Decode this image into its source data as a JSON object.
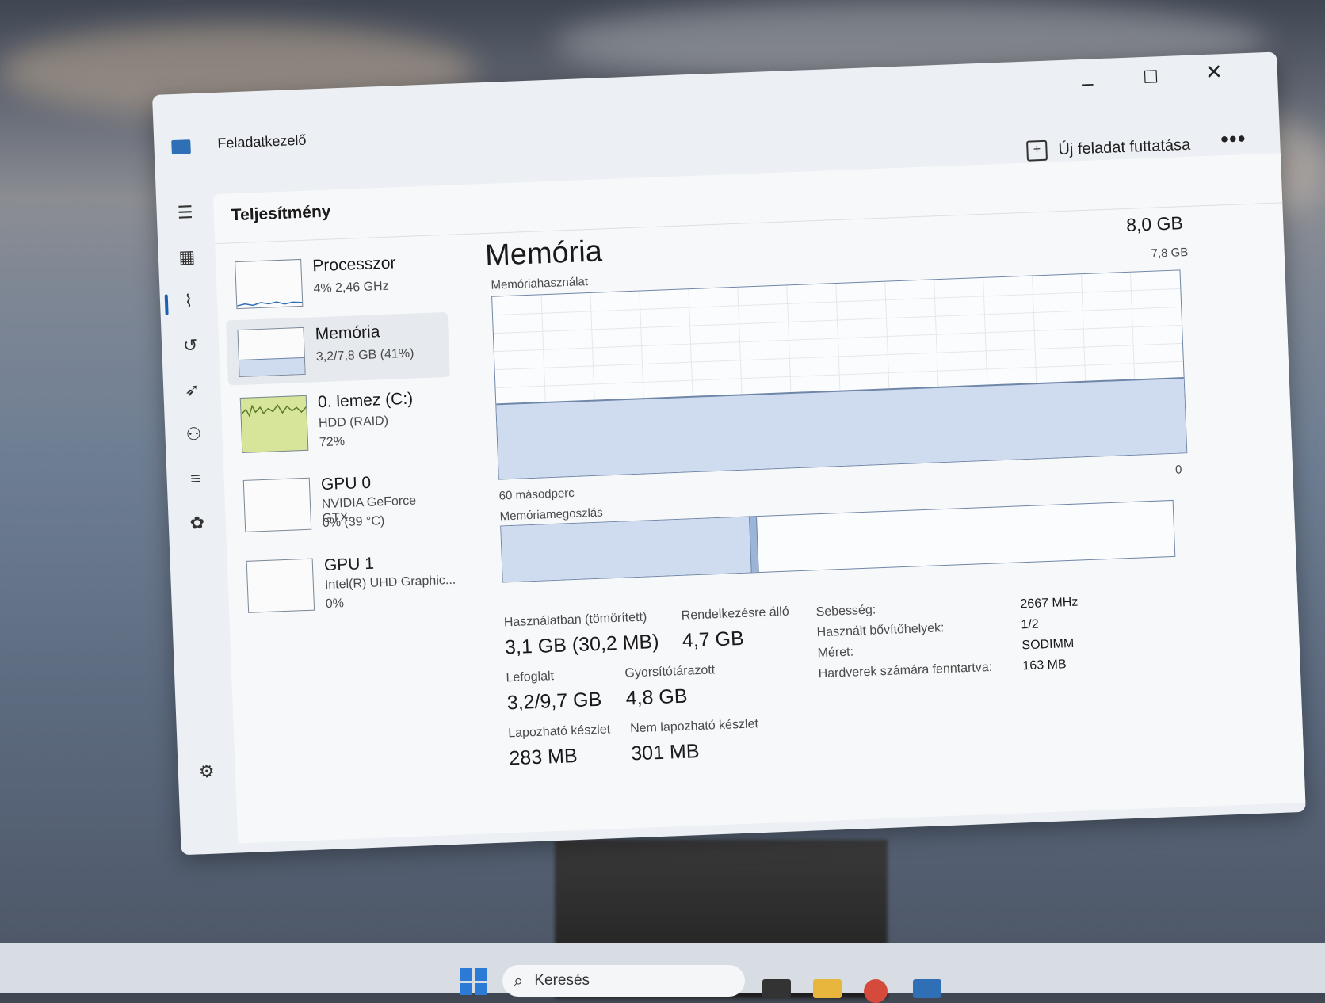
{
  "window": {
    "title": "Feladatkezelő"
  },
  "command_bar": {
    "run_new_task": "Új feladat futtatása",
    "more": "•••"
  },
  "page": {
    "title": "Teljesítmény"
  },
  "tiles": [
    {
      "name": "Processzor",
      "line1": "4% 2,46 GHz",
      "line2": ""
    },
    {
      "name": "Memória",
      "line1": "3,2/7,8 GB (41%)",
      "line2": ""
    },
    {
      "name": "0. lemez (C:)",
      "line1": "HDD (RAID)",
      "line2": "72%"
    },
    {
      "name": "GPU 0",
      "line1": "NVIDIA GeForce GTX...",
      "line2": "0% (39 °C)"
    },
    {
      "name": "GPU 1",
      "line1": "Intel(R) UHD Graphic...",
      "line2": "0%"
    }
  ],
  "memory": {
    "title": "Memória",
    "total": "8,0 GB",
    "chart_max": "7,8 GB",
    "usage_label": "Memóriahasználat",
    "time_label": "60 másodperc",
    "time_zero": "0",
    "composition_label": "Memóriamegoszlás",
    "usage_fraction": 0.41,
    "stats": {
      "in_use_label": "Használatban (tömörített)",
      "in_use_value": "3,1 GB (30,2 MB)",
      "available_label": "Rendelkezésre álló",
      "available_value": "4,7 GB",
      "committed_label": "Lefoglalt",
      "committed_value": "3,2/9,7 GB",
      "cached_label": "Gyorsítótárazott",
      "cached_value": "4,8 GB",
      "paged_label": "Lapozható készlet",
      "paged_value": "283 MB",
      "nonpaged_label": "Nem lapozható készlet",
      "nonpaged_value": "301 MB"
    },
    "props": [
      {
        "label": "Sebesség:",
        "value": "2667 MHz"
      },
      {
        "label": "Használt bővítőhelyek:",
        "value": "1/2"
      },
      {
        "label": "Méret:",
        "value": "SODIMM"
      },
      {
        "label": "Hardverek számára fenntartva:",
        "value": "163 MB"
      }
    ]
  },
  "taskbar": {
    "search_placeholder": "Keresés"
  },
  "colors": {
    "accent": "#1b5fb4",
    "memory_fill": "#cfdcef",
    "disk_fill": "#d7e59a"
  }
}
